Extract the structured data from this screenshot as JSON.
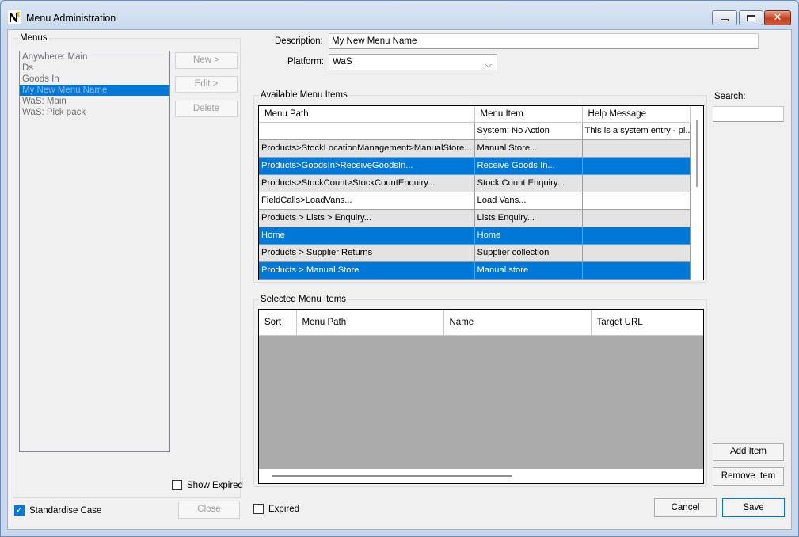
{
  "window": {
    "title": "Menu Administration"
  },
  "menus": {
    "group_label": "Menus",
    "items": [
      "Anywhere: Main",
      "Ds",
      "Goods In",
      "My New Menu Name",
      "WaS: Main",
      "WaS: Pick pack"
    ],
    "selected_index": 3,
    "new_label": "New >",
    "edit_label": "Edit >",
    "delete_label": "Delete",
    "show_expired_label": "Show Expired",
    "standardise_case_label": "Standardise Case",
    "close_label": "Close"
  },
  "form": {
    "description_label": "Description:",
    "description_value": "My New Menu Name",
    "platform_label": "Platform:",
    "platform_value": "WaS"
  },
  "available": {
    "group_label": "Available Menu Items",
    "columns": [
      "Menu Path",
      "Menu Item",
      "Help Message"
    ],
    "rows": [
      {
        "path": "",
        "item": "System: No Action",
        "help": "This is a system entry - pl...",
        "style": "wht"
      },
      {
        "path": "Products>StockLocationManagement>ManualStore...",
        "item": "Manual Store...",
        "help": "",
        "style": "alt"
      },
      {
        "path": "Products>GoodsIn>ReceiveGoodsIn...",
        "item": "Receive Goods In...",
        "help": "",
        "style": "sel"
      },
      {
        "path": "Products>StockCount>StockCountEnquiry...",
        "item": "Stock Count Enquiry...",
        "help": "",
        "style": "alt"
      },
      {
        "path": "FieldCalls>LoadVans...",
        "item": "Load Vans...",
        "help": "",
        "style": "wht"
      },
      {
        "path": "Products > Lists > Enquiry...",
        "item": "Lists Enquiry...",
        "help": "",
        "style": "alt"
      },
      {
        "path": "Home",
        "item": "Home",
        "help": "",
        "style": "sel"
      },
      {
        "path": "Products > Supplier Returns",
        "item": "Supplier collection",
        "help": "",
        "style": "alt"
      },
      {
        "path": "Products > Manual Store",
        "item": "Manual store",
        "help": "",
        "style": "sel"
      }
    ]
  },
  "search": {
    "label": "Search:",
    "value": ""
  },
  "selected": {
    "group_label": "Selected Menu Items",
    "columns": [
      "Sort",
      "Menu Path",
      "Name",
      "Target URL"
    ]
  },
  "actions": {
    "add_item_label": "Add Item",
    "remove_item_label": "Remove Item",
    "expired_label": "Expired",
    "cancel_label": "Cancel",
    "save_label": "Save"
  }
}
